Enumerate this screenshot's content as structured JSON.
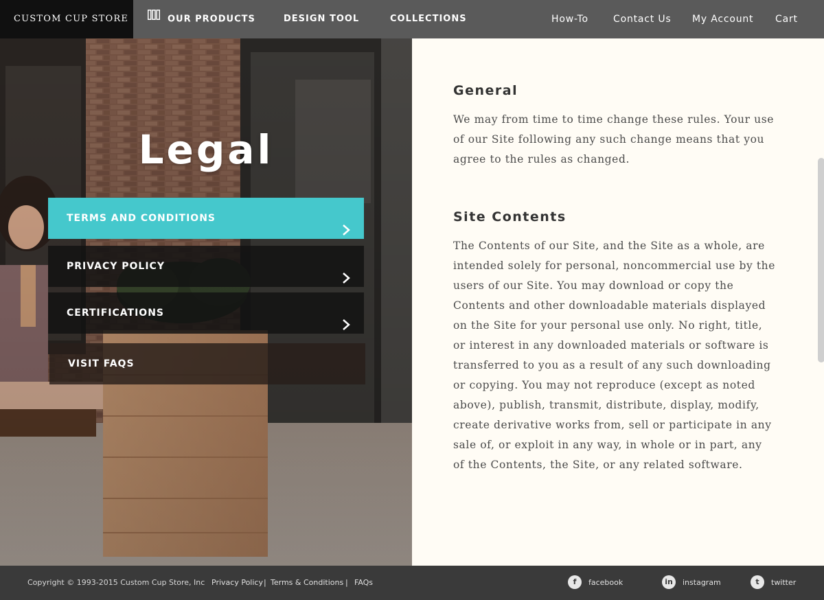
{
  "nav": {
    "brand": "CUSTOM CUP STORE",
    "main": [
      {
        "label": "OUR PRODUCTS",
        "icon": "grid-icon"
      },
      {
        "label": "DESIGN TOOL"
      },
      {
        "label": "COLLECTIONS"
      }
    ],
    "right": [
      "How-To",
      "Contact Us",
      "My Account",
      "Cart"
    ]
  },
  "hero": {
    "title": "Legal",
    "menu": [
      {
        "label": "TERMS AND CONDITIONS",
        "active": true,
        "icon": "chevron-right-icon"
      },
      {
        "label": "PRIVACY POLICY",
        "icon": "chevron-right-icon"
      },
      {
        "label": "CERTIFICATIONS",
        "icon": "chevron-right-icon"
      },
      {
        "label": "VISIT FAQS"
      }
    ]
  },
  "content": {
    "sections": [
      {
        "title": "General",
        "body": "We may from time to time change these rules. Your use of our Site following any such change means that you agree to the rules as changed."
      },
      {
        "title": "Site Contents",
        "body": "The Contents of our Site, and the Site as a whole, are intended solely for personal, noncommercial use by the users of our Site. You may download or copy the Contents and other downloadable materials displayed on the Site for your personal use only. No right, title, or interest in any downloaded materials or software is transferred to you as a result of any such downloading or copying. You may not reproduce (except as noted above), publish, transmit, distribute, display, modify, create derivative works from, sell or participate in any sale of, or exploit in any way, in whole or in part, any of the Contents, the Site, or any related software."
      }
    ]
  },
  "footer": {
    "copyright": "Copyright © 1993-2015 Custom Cup Store, Inc",
    "links": [
      "Privacy Policy",
      "Terms & Conditions",
      "FAQs"
    ],
    "separator": "|",
    "social": [
      {
        "label": "facebook",
        "icon": "facebook-icon",
        "glyph": "f"
      },
      {
        "label": "instagram",
        "icon": "instagram-icon",
        "glyph": "in"
      },
      {
        "label": "twitter",
        "icon": "twitter-icon",
        "glyph": "t"
      }
    ]
  },
  "colors": {
    "nav_bg": "#5a5a5a",
    "brand_bg": "#101010",
    "accent": "#45c8cc",
    "content_bg": "#fffcf5",
    "footer_bg": "#3a3a3a"
  }
}
